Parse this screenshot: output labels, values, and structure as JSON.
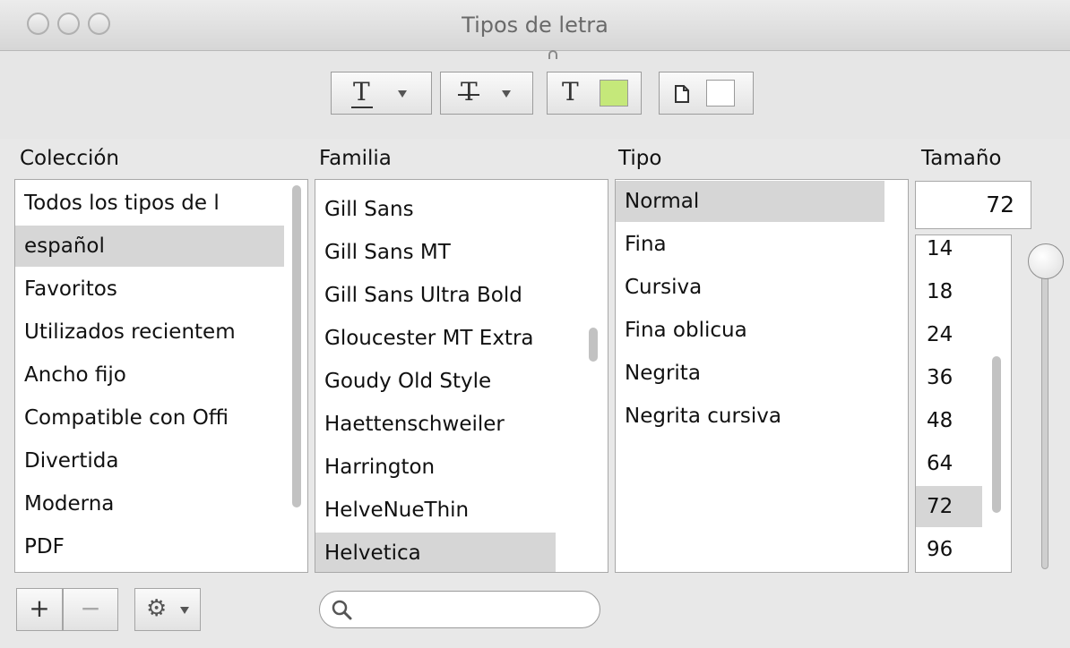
{
  "window": {
    "title": "Tipos de letra"
  },
  "toolbar": {
    "underline_glyph": "T",
    "strike_glyph": "T",
    "text_color_glyph": "T",
    "text_color": "#c5e87a",
    "document_color": "#ffffff"
  },
  "columns": {
    "collection": "Colección",
    "family": "Familia",
    "type": "Tipo",
    "size": "Tamaño"
  },
  "collections": [
    {
      "label": "Todos los tipos de l",
      "selected": false
    },
    {
      "label": "español",
      "selected": true
    },
    {
      "label": "Favoritos",
      "selected": false
    },
    {
      "label": "Utilizados recientem",
      "selected": false
    },
    {
      "label": "Ancho fijo",
      "selected": false
    },
    {
      "label": "Compatible con Offi",
      "selected": false
    },
    {
      "label": "Divertida",
      "selected": false
    },
    {
      "label": "Moderna",
      "selected": false
    },
    {
      "label": "PDF",
      "selected": false
    }
  ],
  "families": [
    {
      "label": "Gill Sans",
      "selected": false
    },
    {
      "label": "Gill Sans MT",
      "selected": false
    },
    {
      "label": "Gill Sans Ultra Bold",
      "selected": false
    },
    {
      "label": "Gloucester MT Extra",
      "selected": false
    },
    {
      "label": "Goudy Old Style",
      "selected": false
    },
    {
      "label": "Haettenschweiler",
      "selected": false
    },
    {
      "label": "Harrington",
      "selected": false
    },
    {
      "label": "HelveNueThin",
      "selected": false
    },
    {
      "label": "Helvetica",
      "selected": true
    }
  ],
  "types": [
    {
      "label": "Normal",
      "selected": true
    },
    {
      "label": "Fina",
      "selected": false
    },
    {
      "label": "Cursiva",
      "selected": false
    },
    {
      "label": "Fina oblicua",
      "selected": false
    },
    {
      "label": "Negrita",
      "selected": false
    },
    {
      "label": "Negrita cursiva",
      "selected": false
    }
  ],
  "size": {
    "value": "72",
    "options": [
      {
        "label": "14",
        "selected": false
      },
      {
        "label": "18",
        "selected": false
      },
      {
        "label": "24",
        "selected": false
      },
      {
        "label": "36",
        "selected": false
      },
      {
        "label": "48",
        "selected": false
      },
      {
        "label": "64",
        "selected": false
      },
      {
        "label": "72",
        "selected": true
      },
      {
        "label": "96",
        "selected": false
      }
    ]
  },
  "bottom": {
    "add_label": "+",
    "remove_label": "−",
    "search_placeholder": ""
  }
}
